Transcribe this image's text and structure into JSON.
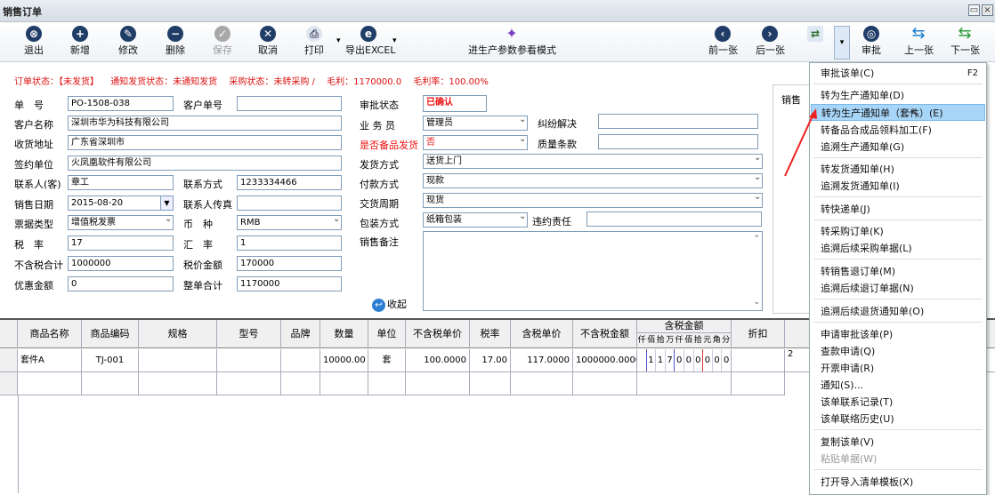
{
  "window": {
    "title": "销售订单"
  },
  "toolbar": {
    "exit": "退出",
    "add": "新增",
    "edit": "修改",
    "delete": "删除",
    "save": "保存",
    "cancel": "取消",
    "print": "打印",
    "export": "导出EXCEL",
    "production_mode": "进生产参数参看模式",
    "prev": "前一张",
    "next": "后一张",
    "approve": "审批",
    "up": "上一张",
    "down": "下一张"
  },
  "status": {
    "order_status": "订单状态：【未发货】",
    "notify_status": "通知发货状态：未通知发货",
    "purchase_status": "采购状态：未转采购 /",
    "gross_profit": "毛利：1170000.0",
    "gross_margin": "毛利率：100.00%"
  },
  "form": {
    "order_no_label": "单　号",
    "order_no": "PO-1508-038",
    "customer_no_label": "客户单号",
    "customer_no": "",
    "customer_name_label": "客户名称",
    "customer_name": "深圳市华为科技有限公司",
    "address_label": "收货地址",
    "address": "广东省深圳市",
    "sign_unit_label": "签约单位",
    "sign_unit": "火凤凰软件有限公司",
    "contact_label": "联系人(客)",
    "contact": "章工",
    "contact_method_label": "联系方式",
    "contact_method": "1233334466",
    "sale_date_label": "销售日期",
    "sale_date": "2015-08-20",
    "contact_fax_label": "联系人传真",
    "contact_fax": "",
    "invoice_type_label": "票据类型",
    "invoice_type": "增值税发票",
    "currency_label": "币　种",
    "currency": "RMB",
    "tax_rate_label": "税　率",
    "tax_rate": "17",
    "exchange_label": "汇　率",
    "exchange": "1",
    "untaxed_total_label": "不含税合计",
    "untaxed_total": "1000000",
    "tax_amount_label": "税价金额",
    "tax_amount": "170000",
    "discount_label": "优惠金额",
    "discount": "0",
    "order_total_label": "整单合计",
    "order_total": "1170000",
    "approval_label": "审批状态",
    "approval": "已确认",
    "salesman_label": "业 务 员",
    "salesman": "管理员",
    "dispute_label": "纠纷解决",
    "dispute": "",
    "backup_label": "是否备品发货",
    "backup": "否",
    "quality_label": "质量条款",
    "quality": "",
    "ship_method_label": "发货方式",
    "ship_method": "送货上门",
    "payment_label": "付款方式",
    "payment": "现款",
    "delivery_label": "交货周期",
    "delivery": "现货",
    "packing_label": "包装方式",
    "packing": "纸箱包装",
    "breach_label": "违约责任",
    "breach": "",
    "remark_label": "销售备注",
    "collapse": "收起",
    "side_label": "销售"
  },
  "grid": {
    "headers": [
      "商品名称",
      "商品编码",
      "规格",
      "型号",
      "品牌",
      "数量",
      "单位",
      "不含税单价",
      "税率",
      "含税单价",
      "不含税金额",
      "含税金额",
      "折扣"
    ],
    "amount_digits": [
      "仟",
      "佰",
      "拾",
      "万",
      "仟",
      "佰",
      "拾",
      "元",
      "角",
      "分"
    ],
    "rows": [
      {
        "name": "套件A",
        "code": "TJ-001",
        "spec": "",
        "model": "",
        "brand": "",
        "qty": "10000.00",
        "unit": "套",
        "price": "100.0000",
        "tax": "17.00",
        "taxprice": "117.0000",
        "amount": "1000000.0000",
        "digits": [
          "",
          "1",
          "1",
          "7",
          "0",
          "0",
          "0",
          "0",
          "0",
          "0"
        ],
        "discount": ""
      }
    ],
    "extra": "2"
  },
  "menu": {
    "items": [
      {
        "label": "审批该单(C)",
        "shortcut": "F2"
      },
      {
        "label": "转为生产通知单(D)"
      },
      {
        "label": "转为生产通知单（套件）(E)"
      },
      {
        "label": "转备品合成品领料加工(F)"
      },
      {
        "label": "追溯生产通知单(G)"
      },
      {
        "label": "转发货通知单(H)"
      },
      {
        "label": "追溯发货通知单(I)"
      },
      {
        "label": "转快递单(J)"
      },
      {
        "label": "转采购订单(K)"
      },
      {
        "label": "追溯后续采购单据(L)"
      },
      {
        "label": "转销售退订单(M)"
      },
      {
        "label": "追溯后续退订单据(N)"
      },
      {
        "label": "追溯后续退货通知单(O)"
      },
      {
        "label": "申请审批该单(P)"
      },
      {
        "label": "查款申请(Q)"
      },
      {
        "label": "开票申请(R)"
      },
      {
        "label": "通知(S)..."
      },
      {
        "label": "该单联系记录(T)"
      },
      {
        "label": "该单联络历史(U)"
      },
      {
        "label": "复制该单(V)"
      },
      {
        "label": "粘贴单据(W)"
      },
      {
        "label": "打开导入清单模板(X)"
      }
    ]
  }
}
